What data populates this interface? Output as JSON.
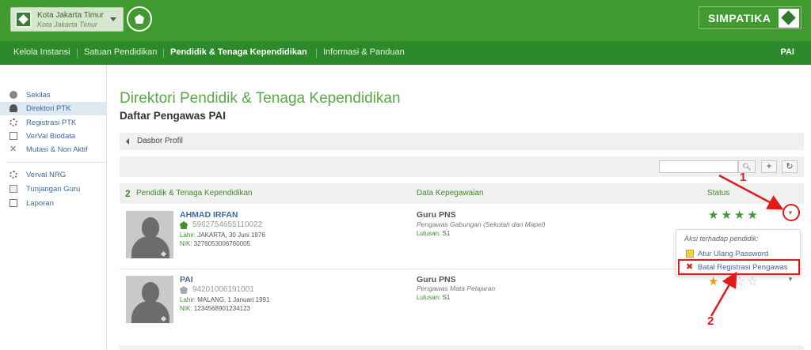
{
  "topbar": {
    "institution": {
      "name": "Kota Jakarta Timur",
      "subtitle": "Kota Jakarta Timur"
    },
    "app_name": "SIMPATIKA"
  },
  "nav": {
    "items": [
      "Kelola Instansi",
      "Satuan Pendidikan",
      "Pendidik & Tenaga Kependidikan",
      "Informasi & Panduan"
    ],
    "active_index": 2,
    "right_label": "PAI"
  },
  "sidebar": {
    "items": [
      {
        "label": "Sekilas",
        "icon": "info-icon"
      },
      {
        "label": "Direktori PTK",
        "icon": "person-icon",
        "active": true
      },
      {
        "label": "Registrasi PTK",
        "icon": "gear-icon"
      },
      {
        "label": "VerVal Biodata",
        "icon": "checkbox-icon"
      },
      {
        "label": "Mutasi & Non Aktif",
        "icon": "cross-icon"
      },
      {
        "label": "Verval NRG",
        "icon": "gear-icon"
      },
      {
        "label": "Tunjangan Guru",
        "icon": "image-icon"
      },
      {
        "label": "Laporan",
        "icon": "document-icon"
      }
    ]
  },
  "main": {
    "title": "Direktori Pendidik & Tenaga Kependidikan",
    "subtitle": "Daftar Pengawas PAI",
    "breadcrumb": "Dasbor Profil",
    "search": {
      "placeholder": ""
    },
    "table_header": {
      "count": "2",
      "count_label": "Pendidik & Tenaga Kependidikan",
      "data_label": "Data Kepegawaian",
      "status_label": "Status"
    },
    "rows": [
      {
        "name": "AHMAD IRFAN",
        "id": "5962754655110022",
        "lahir_label": "Lahir:",
        "lahir": "JAKARTA, 30 Juni 1976",
        "nik_label": "NIK:",
        "nik": "3276053006760005",
        "position": "Guru PNS",
        "role": "Pengawas Gabungan (Sekolah dan Mapel)",
        "lulusan_label": "Lulusan:",
        "lulusan": "S1",
        "stars_filled": 4
      },
      {
        "name": "PAI",
        "id": "94201006191001",
        "lahir_label": "Lahir:",
        "lahir": "MALANG, 1 Januari 1991",
        "nik_label": "NIK:",
        "nik": "1234568901234123",
        "position": "Guru PNS",
        "role": "Pengawas Mata Pelajaran",
        "lulusan_label": "Lulusan:",
        "lulusan": "S1",
        "stars_filled": 1
      }
    ]
  },
  "dropdown": {
    "heading": "Aksi terhadap pendidik:",
    "items": [
      "Atur Ulang Password",
      "Batal Registrasi Pengawas"
    ]
  },
  "annotations": {
    "step1": "1",
    "step2": "2"
  },
  "colors": {
    "brand_green": "#3f9a2f",
    "nav_green": "#2d8a2a",
    "title_green": "#5ba84a",
    "link_blue": "#3c6aa0",
    "annotation_red": "#e31a1a"
  }
}
